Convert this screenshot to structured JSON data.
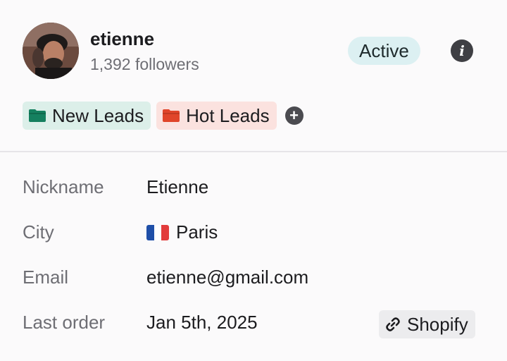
{
  "profile": {
    "username": "etienne",
    "followers": "1,392 followers",
    "status": "Active"
  },
  "tags": [
    {
      "label": "New Leads",
      "color": "#15805f",
      "bg": "#dcefe9"
    },
    {
      "label": "Hot Leads",
      "color": "#e0452a",
      "bg": "#fbe2df"
    }
  ],
  "details": {
    "nickname": {
      "label": "Nickname",
      "value": "Etienne"
    },
    "city": {
      "label": "City",
      "value": "Paris",
      "flag": "france-flag"
    },
    "email": {
      "label": "Email",
      "value": "etienne@gmail.com"
    },
    "last_order": {
      "label": "Last order",
      "value": "Jan 5th, 2025",
      "source": "Shopify"
    }
  },
  "colors": {
    "status_bg": "#dcf0f2",
    "divider": "#e6e4e8"
  },
  "icons": [
    "info-icon",
    "folder-icon",
    "add-icon",
    "link-icon"
  ]
}
